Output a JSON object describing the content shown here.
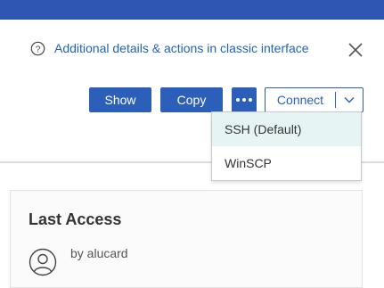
{
  "info": {
    "link_text": "Additional details & actions in classic interface",
    "help_icon": "help-circle-icon",
    "close_icon": "close-icon"
  },
  "actions": {
    "show_label": "Show",
    "copy_label": "Copy",
    "more_icon": "ellipsis-icon",
    "connect_label": "Connect",
    "connect_caret_icon": "chevron-down-icon"
  },
  "connect_menu": {
    "items": [
      {
        "label": "SSH (Default)",
        "highlighted": true
      },
      {
        "label": "WinSCP",
        "highlighted": false
      }
    ]
  },
  "last_access": {
    "title": "Last Access",
    "by_text": "by alucard",
    "user_icon": "user-icon"
  },
  "colors": {
    "header_bar": "#2f56b3",
    "primary": "#2b5fb9",
    "link": "#1f63b8",
    "menu_highlight": "#e6f5f3"
  }
}
